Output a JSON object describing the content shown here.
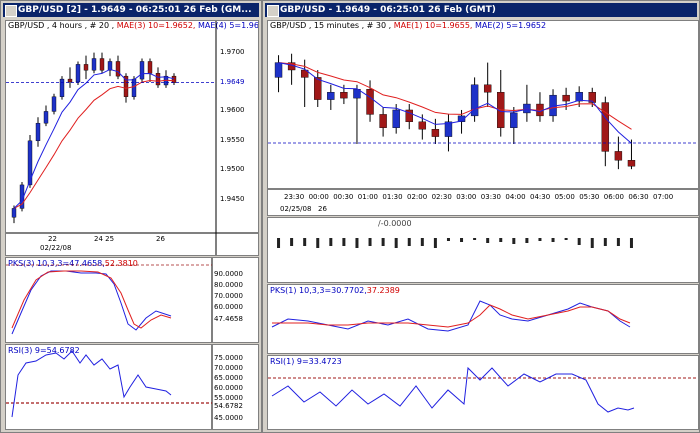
{
  "left": {
    "title": "GBP/USD [2] - 1.9649 - 06:25:01 26 Feb (GM...",
    "header": {
      "sym": "GBP/USD , 4 hours , # 20 ,",
      "mae1": "MAE(3) 10=1.9652,",
      "mae2": "MAE(4) 5=1.9655"
    },
    "price_ticks": [
      "1.9700",
      "1.9650",
      "1.9600",
      "1.9550",
      "1.9500",
      "1.9450"
    ],
    "last_price": "1.9649",
    "x_ticks": [
      "22",
      "24 25",
      "26"
    ],
    "date_label": "02/22/08",
    "pks": {
      "label_blue": "PKS(3) 10,3,3=47.4658,",
      "label_red": "52.3810",
      "ticks": [
        "90.0000",
        "80.0000",
        "70.0000",
        "60.0000"
      ],
      "last": "47.4658"
    },
    "rsi": {
      "label": "RSI(3) 9=54.6782",
      "ticks": [
        "75.0000",
        "70.0000",
        "65.0000",
        "60.0000",
        "55.0000",
        "45.0000"
      ],
      "last": "54.6782"
    }
  },
  "right": {
    "title": "GBP/USD - 1.9649 - 06:25:01 26 Feb (GMT)",
    "header": {
      "sym": "GBP/USD , 15 minutes , # 30 ,",
      "mae1": "MAE(1) 10=1.9655,",
      "mae2": "MAE(2) 5=1.9652"
    },
    "x_ticks": [
      "23:30",
      "00:00",
      "00:30",
      "01:00",
      "01:30",
      "02:00",
      "02:30",
      "03:00",
      "03:30",
      "04:00",
      "04:30",
      "05:00",
      "05:30",
      "06:00",
      "06:30",
      "07:00"
    ],
    "date_label": "02/25/08",
    "date_day": "26",
    "vol_label": "/-0.0000",
    "pks_label_blue": "PKS(1) 10,3,3=30.7702,",
    "pks_label_red": "37.2389",
    "rsi_label": "RSI(1) 9=33.4723"
  },
  "colors": {
    "up": "#1e32c8",
    "down": "#a01818",
    "ma_red": "#e02020",
    "ma_blue": "#2020e0"
  },
  "chart_data": [
    {
      "type": "candlestick",
      "title": "GBP/USD 4 hours",
      "ylim": [
        1.94,
        1.973
      ],
      "candles": [
        {
          "o": 1.942,
          "h": 1.944,
          "l": 1.941,
          "c": 1.9435
        },
        {
          "o": 1.9435,
          "h": 1.948,
          "l": 1.943,
          "c": 1.9475
        },
        {
          "o": 1.9475,
          "h": 1.956,
          "l": 1.947,
          "c": 1.955
        },
        {
          "o": 1.955,
          "h": 1.959,
          "l": 1.954,
          "c": 1.958
        },
        {
          "o": 1.958,
          "h": 1.961,
          "l": 1.9575,
          "c": 1.96
        },
        {
          "o": 1.96,
          "h": 1.963,
          "l": 1.9595,
          "c": 1.9625
        },
        {
          "o": 1.9625,
          "h": 1.966,
          "l": 1.962,
          "c": 1.9655
        },
        {
          "o": 1.9655,
          "h": 1.9675,
          "l": 1.964,
          "c": 1.965
        },
        {
          "o": 1.965,
          "h": 1.9685,
          "l": 1.9645,
          "c": 1.968
        },
        {
          "o": 1.968,
          "h": 1.9695,
          "l": 1.9655,
          "c": 1.967
        },
        {
          "o": 1.967,
          "h": 1.97,
          "l": 1.9665,
          "c": 1.969
        },
        {
          "o": 1.969,
          "h": 1.97,
          "l": 1.9665,
          "c": 1.967
        },
        {
          "o": 1.967,
          "h": 1.969,
          "l": 1.966,
          "c": 1.9685
        },
        {
          "o": 1.9685,
          "h": 1.9695,
          "l": 1.9655,
          "c": 1.966
        },
        {
          "o": 1.966,
          "h": 1.9665,
          "l": 1.9615,
          "c": 1.9625
        },
        {
          "o": 1.9625,
          "h": 1.966,
          "l": 1.962,
          "c": 1.9655
        },
        {
          "o": 1.9655,
          "h": 1.969,
          "l": 1.965,
          "c": 1.9685
        },
        {
          "o": 1.9685,
          "h": 1.969,
          "l": 1.965,
          "c": 1.9665
        },
        {
          "o": 1.9665,
          "h": 1.9675,
          "l": 1.964,
          "c": 1.9645
        },
        {
          "o": 1.9645,
          "h": 1.967,
          "l": 1.964,
          "c": 1.966
        },
        {
          "o": 1.966,
          "h": 1.9665,
          "l": 1.9645,
          "c": 1.9649
        }
      ]
    },
    {
      "type": "candlestick",
      "title": "GBP/USD 15 minutes",
      "ylim": [
        1.962,
        1.972
      ],
      "candles": [
        {
          "o": 1.969,
          "h": 1.9705,
          "l": 1.968,
          "c": 1.97
        },
        {
          "o": 1.97,
          "h": 1.9706,
          "l": 1.9685,
          "c": 1.9695
        },
        {
          "o": 1.9695,
          "h": 1.9702,
          "l": 1.967,
          "c": 1.969
        },
        {
          "o": 1.969,
          "h": 1.9695,
          "l": 1.967,
          "c": 1.9675
        },
        {
          "o": 1.9675,
          "h": 1.9685,
          "l": 1.9668,
          "c": 1.968
        },
        {
          "o": 1.968,
          "h": 1.9685,
          "l": 1.9672,
          "c": 1.9676
        },
        {
          "o": 1.9676,
          "h": 1.9685,
          "l": 1.9645,
          "c": 1.9682
        },
        {
          "o": 1.9682,
          "h": 1.9688,
          "l": 1.966,
          "c": 1.9665
        },
        {
          "o": 1.9665,
          "h": 1.967,
          "l": 1.965,
          "c": 1.9656
        },
        {
          "o": 1.9656,
          "h": 1.9672,
          "l": 1.9652,
          "c": 1.9668
        },
        {
          "o": 1.9668,
          "h": 1.9672,
          "l": 1.9655,
          "c": 1.966
        },
        {
          "o": 1.966,
          "h": 1.9665,
          "l": 1.9648,
          "c": 1.9655
        },
        {
          "o": 1.9655,
          "h": 1.9662,
          "l": 1.9645,
          "c": 1.965
        },
        {
          "o": 1.965,
          "h": 1.9665,
          "l": 1.964,
          "c": 1.966
        },
        {
          "o": 1.966,
          "h": 1.9668,
          "l": 1.9652,
          "c": 1.9664
        },
        {
          "o": 1.9664,
          "h": 1.969,
          "l": 1.966,
          "c": 1.9685
        },
        {
          "o": 1.9685,
          "h": 1.97,
          "l": 1.967,
          "c": 1.968
        },
        {
          "o": 1.968,
          "h": 1.9695,
          "l": 1.965,
          "c": 1.9656
        },
        {
          "o": 1.9656,
          "h": 1.967,
          "l": 1.9645,
          "c": 1.9666
        },
        {
          "o": 1.9666,
          "h": 1.9685,
          "l": 1.966,
          "c": 1.9672
        },
        {
          "o": 1.9672,
          "h": 1.968,
          "l": 1.966,
          "c": 1.9664
        },
        {
          "o": 1.9664,
          "h": 1.9682,
          "l": 1.966,
          "c": 1.9678
        },
        {
          "o": 1.9678,
          "h": 1.9683,
          "l": 1.9668,
          "c": 1.9674
        },
        {
          "o": 1.9674,
          "h": 1.9684,
          "l": 1.967,
          "c": 1.968
        },
        {
          "o": 1.968,
          "h": 1.9683,
          "l": 1.967,
          "c": 1.9673
        },
        {
          "o": 1.9673,
          "h": 1.9677,
          "l": 1.963,
          "c": 1.964
        },
        {
          "o": 1.964,
          "h": 1.965,
          "l": 1.9628,
          "c": 1.9634
        },
        {
          "o": 1.9634,
          "h": 1.9648,
          "l": 1.9628,
          "c": 1.963
        }
      ]
    }
  ]
}
